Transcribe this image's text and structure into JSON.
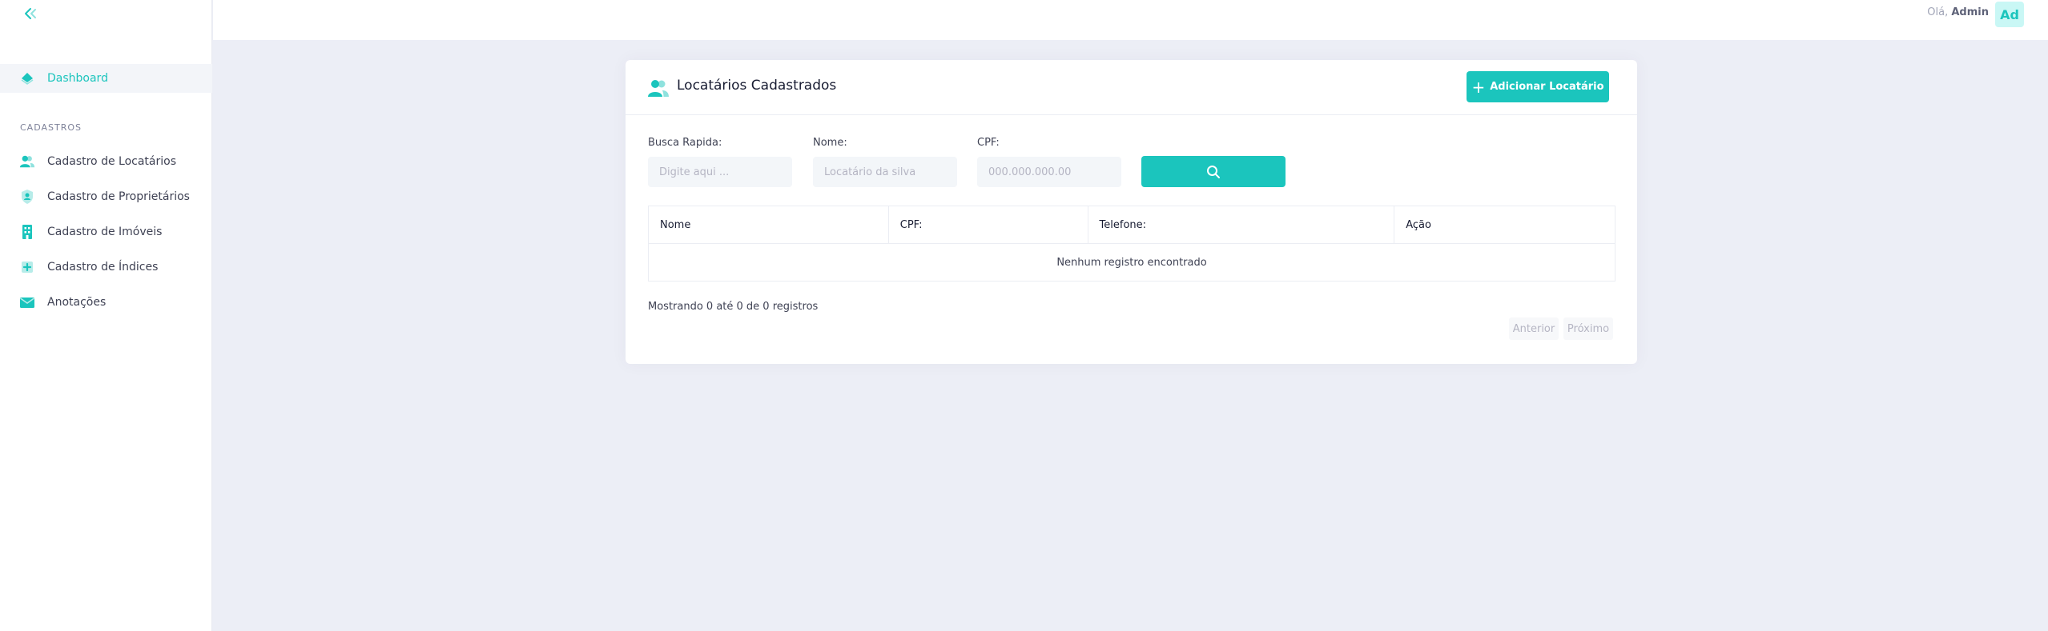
{
  "sidebar": {
    "collapse_icon": "chevron-double-left-icon",
    "dashboard": {
      "label": "Dashboard",
      "icon": "diamond-icon"
    },
    "section_title": "CADASTROS",
    "items": [
      {
        "label": "Cadastro de Locatários",
        "icon": "users-icon"
      },
      {
        "label": "Cadastro de Proprietários",
        "icon": "shield-icon"
      },
      {
        "label": "Cadastro de Imóveis",
        "icon": "building-icon"
      },
      {
        "label": "Cadastro de Índices",
        "icon": "plus-square-icon"
      },
      {
        "label": "Anotações",
        "icon": "mail-icon"
      }
    ]
  },
  "header": {
    "greeting_prefix": "Olá,",
    "user_name": "Admin",
    "avatar_initials": "Ad"
  },
  "card": {
    "title": "Locatários Cadastrados",
    "add_button_label": "Adicionar Locatário",
    "filters": {
      "quick_search": {
        "label": "Busca Rapida:",
        "placeholder": "Digite aqui ..."
      },
      "name": {
        "label": "Nome:",
        "placeholder": "Locatário da silva"
      },
      "cpf": {
        "label": "CPF:",
        "placeholder": "000.000.000.00"
      }
    },
    "table": {
      "columns": [
        "Nome",
        "CPF:",
        "Telefone:",
        "Ação"
      ],
      "empty_message": "Nenhum registro encontrado"
    },
    "showing_text": "Mostrando 0 até 0 de 0 registros",
    "pagination": {
      "previous": "Anterior",
      "next": "Próximo"
    }
  },
  "colors": {
    "accent": "#1bc5bd",
    "accent_light": "#c9f7f5",
    "page_background": "#eceef6"
  }
}
